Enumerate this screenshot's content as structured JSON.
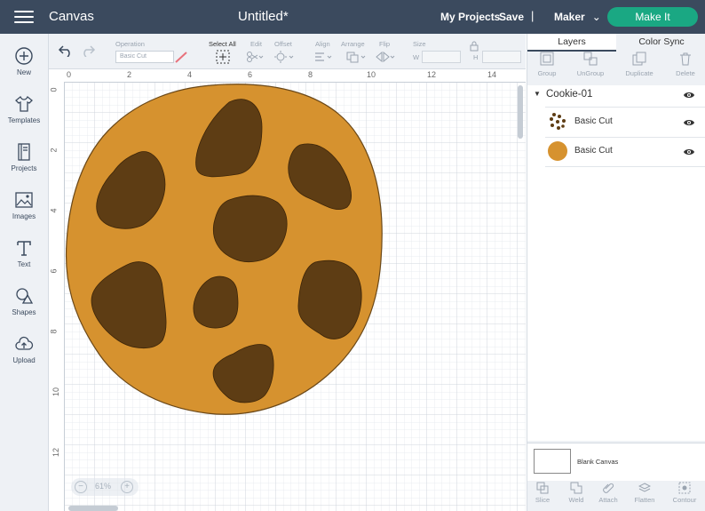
{
  "header": {
    "app_title": "Canvas",
    "doc_title": "Untitled*",
    "my_projects": "My Projects",
    "save": "Save",
    "separator": "|",
    "machine": "Maker",
    "make_it": "Make It",
    "accent_color": "#1aa883",
    "bar_color": "#3b4a5e"
  },
  "left_tools": [
    {
      "label": "New",
      "icon": "plus-circle-icon"
    },
    {
      "label": "Templates",
      "icon": "tshirt-icon"
    },
    {
      "label": "Projects",
      "icon": "book-icon"
    },
    {
      "label": "Images",
      "icon": "image-icon"
    },
    {
      "label": "Text",
      "icon": "text-t-icon"
    },
    {
      "label": "Shapes",
      "icon": "shapes-icon"
    },
    {
      "label": "Upload",
      "icon": "cloud-upload-icon"
    }
  ],
  "options": {
    "operation_label": "Operation",
    "operation_value": "Basic Cut",
    "select_all": "Select All",
    "edit": "Edit",
    "offset": "Offset",
    "align": "Align",
    "arrange": "Arrange",
    "flip": "Flip",
    "size": "Size",
    "w": "W",
    "h": "H"
  },
  "canvas": {
    "ruler_top": [
      "0",
      "2",
      "4",
      "6",
      "8",
      "10",
      "12",
      "14"
    ],
    "ruler_left": [
      "0",
      "2",
      "4",
      "6",
      "8",
      "10",
      "12"
    ],
    "zoom": "61%",
    "cookie_color": "#d6922f",
    "chip_color": "#5e3d14"
  },
  "panel": {
    "tabs": [
      "Layers",
      "Color Sync"
    ],
    "tools": [
      "Group",
      "UnGroup",
      "Duplicate",
      "Delete"
    ],
    "group_name": "Cookie-01",
    "layers": [
      {
        "name": "Basic Cut",
        "thumb": "chips"
      },
      {
        "name": "Basic Cut",
        "thumb": "circle"
      }
    ],
    "blank_canvas": "Blank Canvas",
    "bottom_tools": [
      "Slice",
      "Weld",
      "Attach",
      "Flatten",
      "Contour"
    ]
  }
}
